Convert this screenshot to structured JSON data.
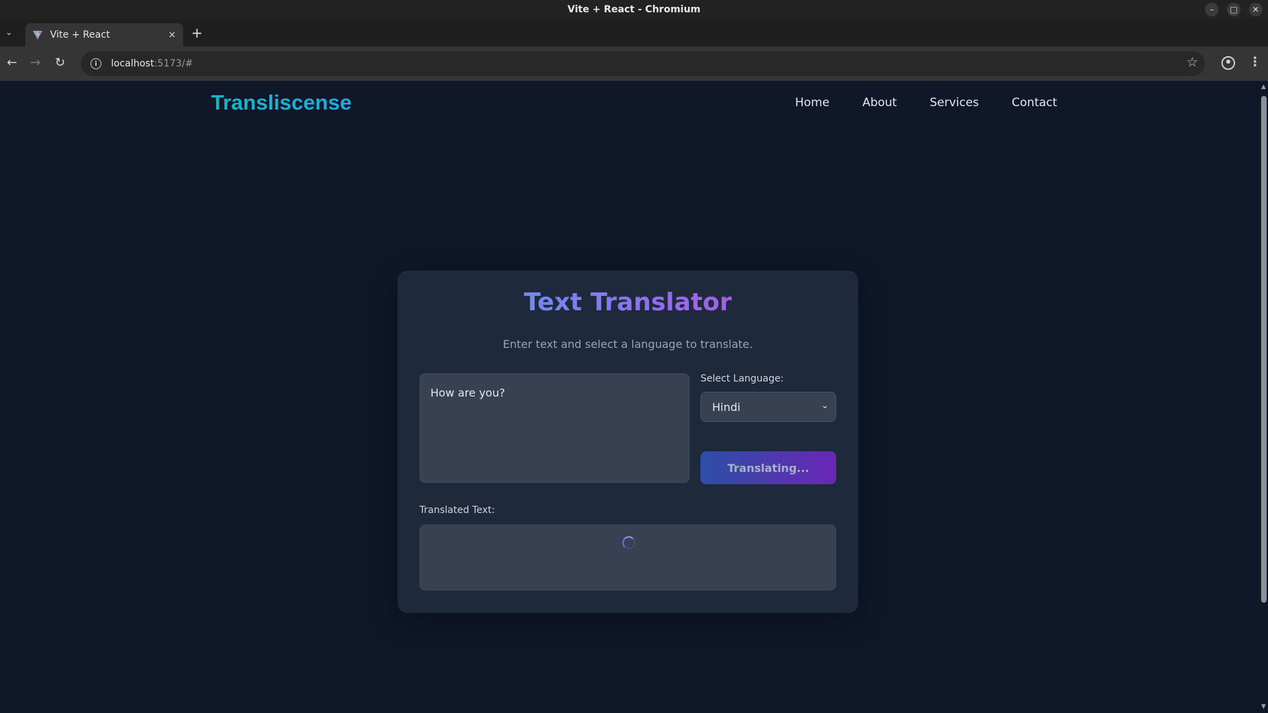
{
  "window": {
    "title": "Vite + React - Chromium",
    "controls": [
      "–",
      "□",
      "✕"
    ]
  },
  "tabs": [
    {
      "label": "Vite + React",
      "close": "×"
    }
  ],
  "toolbar": {
    "url_host": "localhost",
    "url_rest": ":5173/#"
  },
  "site": {
    "brand": "Transliscense",
    "nav": [
      "Home",
      "About",
      "Services",
      "Contact"
    ]
  },
  "translator": {
    "title": "Text Translator",
    "subtitle": "Enter text and select a language to translate.",
    "input_value": "How are you?",
    "language_label": "Select Language:",
    "language_selected": "Hindi",
    "button_label": "Translating...",
    "output_label": "Translated Text:",
    "output_value": "",
    "loading": true
  },
  "colors": {
    "brand_gradient": [
      "#14b8c6",
      "#22a8e0"
    ],
    "title_gradient": [
      "#6f8bf2",
      "#a45ee8"
    ],
    "button_gradient": [
      "#2d4fa6",
      "#6a26b6"
    ],
    "page_bg": "#0f1729",
    "card_bg": "#1e293b"
  },
  "icons": {
    "tab_favicon": "vite-logo-icon",
    "back": "arrow-left-icon",
    "forward": "arrow-right-icon",
    "reload": "reload-icon",
    "site_info": "info-icon",
    "bookmark": "star-icon",
    "profile": "profile-icon",
    "menu": "kebab-menu-icon",
    "spinner": "loading-spinner-icon"
  }
}
